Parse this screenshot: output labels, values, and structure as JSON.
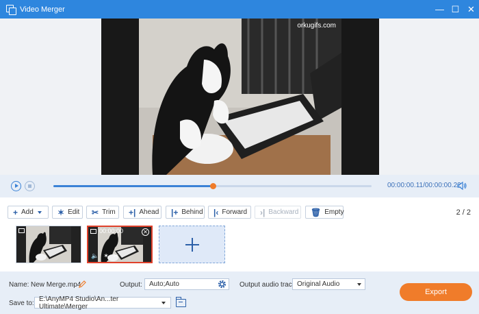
{
  "window": {
    "title": "Video Merger",
    "controls": {
      "minimize": "—",
      "maximize": "☐",
      "close": "✕"
    }
  },
  "preview": {
    "watermark": "orkugifs.com"
  },
  "playback": {
    "time": "00:00:00.11/00:00:00.22",
    "progress": 0.5
  },
  "toolbar": {
    "add": "Add",
    "edit": "Edit",
    "trim": "Trim",
    "ahead": "Ahead",
    "behind": "Behind",
    "forward": "Forward",
    "backward": "Backward",
    "empty": "Empty",
    "page_counter": "2 / 2"
  },
  "clips": [
    {
      "selected": false,
      "time": ""
    },
    {
      "selected": true,
      "time": "00:00:00"
    }
  ],
  "bottom": {
    "name_label": "Name:",
    "name_value": "New Merge.mp4",
    "output_label": "Output:",
    "output_value": "Auto;Auto",
    "audio_label": "Output audio track:",
    "audio_value": "Original Audio",
    "save_label": "Save to:",
    "save_value": "E:\\AnyMP4 Studio\\An...ter Ultimate\\Merger",
    "export_label": "Export"
  },
  "colors": {
    "accent": "#2e86de",
    "export": "#f07c2a",
    "selection": "#e0402a"
  }
}
